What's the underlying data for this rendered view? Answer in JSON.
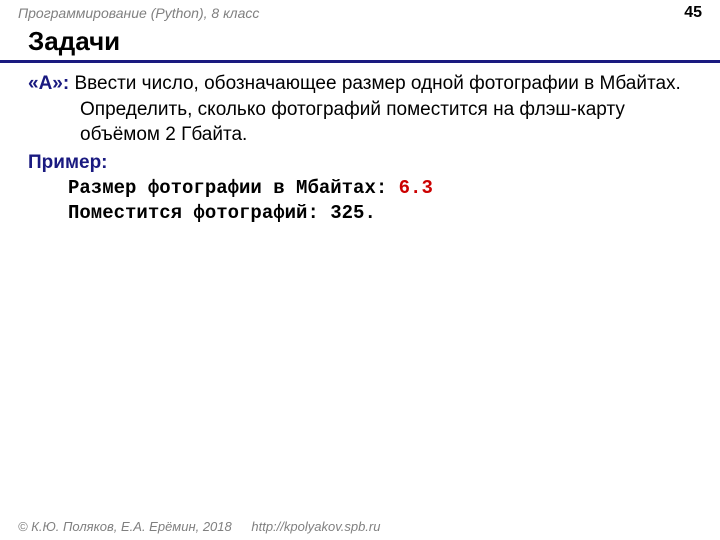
{
  "header": {
    "course": "Программирование (Python), 8 класс",
    "page_number": "45"
  },
  "title": "Задачи",
  "task": {
    "label": "«A»:",
    "text": "Ввести число, обозначающее размер одной фотографии в Мбайтах. Определить, сколько фотографий поместится на флэш-карту объёмом 2 Гбайта."
  },
  "example": {
    "label": "Пример:",
    "line1_prompt": "Размер фотографии в Мбайтах: ",
    "line1_value": "6.3",
    "line2": "Поместится фотографий: 325."
  },
  "footer": {
    "copyright": "© К.Ю. Поляков, Е.А. Ерёмин, 2018",
    "url": "http://kpolyakov.spb.ru"
  }
}
